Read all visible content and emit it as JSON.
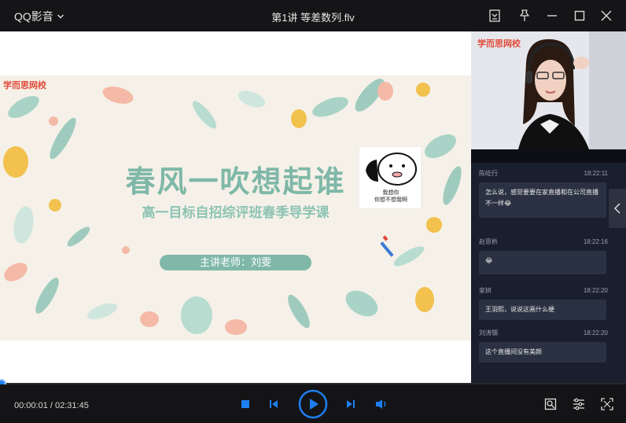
{
  "app": {
    "name": "QQ影音"
  },
  "window": {
    "title": "第1讲 等差数列.flv"
  },
  "slide": {
    "brand": "学而思网校",
    "title": "春风一吹想起谁",
    "subtitle": "高一目标自招综评班春季导学课",
    "teacher": "主讲老师：刘雯",
    "sticker_text_1": "我想你",
    "sticker_text_2": "你想不想我啊"
  },
  "webcam": {
    "brand": "学而思网校"
  },
  "chat": {
    "messages": [
      {
        "user": "陈屹行",
        "time": "18:22:11",
        "text": "怎么说，感觉要要在家直播和在公司直播不一样😂"
      },
      {
        "user": "赵思析",
        "time": "18:22:16",
        "text": "😂"
      },
      {
        "user": "家树",
        "time": "18:22:20",
        "text": "王羽熙，说说这画什么梗"
      },
      {
        "user": "刘涛钿",
        "time": "18:22:20",
        "text": "这个直播间没有美颜"
      }
    ]
  },
  "player": {
    "current_time": "00:00:01",
    "separator": " / ",
    "total_time": "02:31:45",
    "progress_fraction": 0.0001,
    "accent": "#1e7ff0"
  },
  "icons": {
    "titlebar": [
      "screenshot-icon",
      "pin-icon",
      "minimize-icon",
      "maximize-icon",
      "close-icon"
    ],
    "controls": [
      "stop-icon",
      "previous-icon",
      "play-icon",
      "next-icon",
      "volume-icon",
      "capture-icon",
      "settings-icon",
      "fullscreen-icon"
    ]
  }
}
